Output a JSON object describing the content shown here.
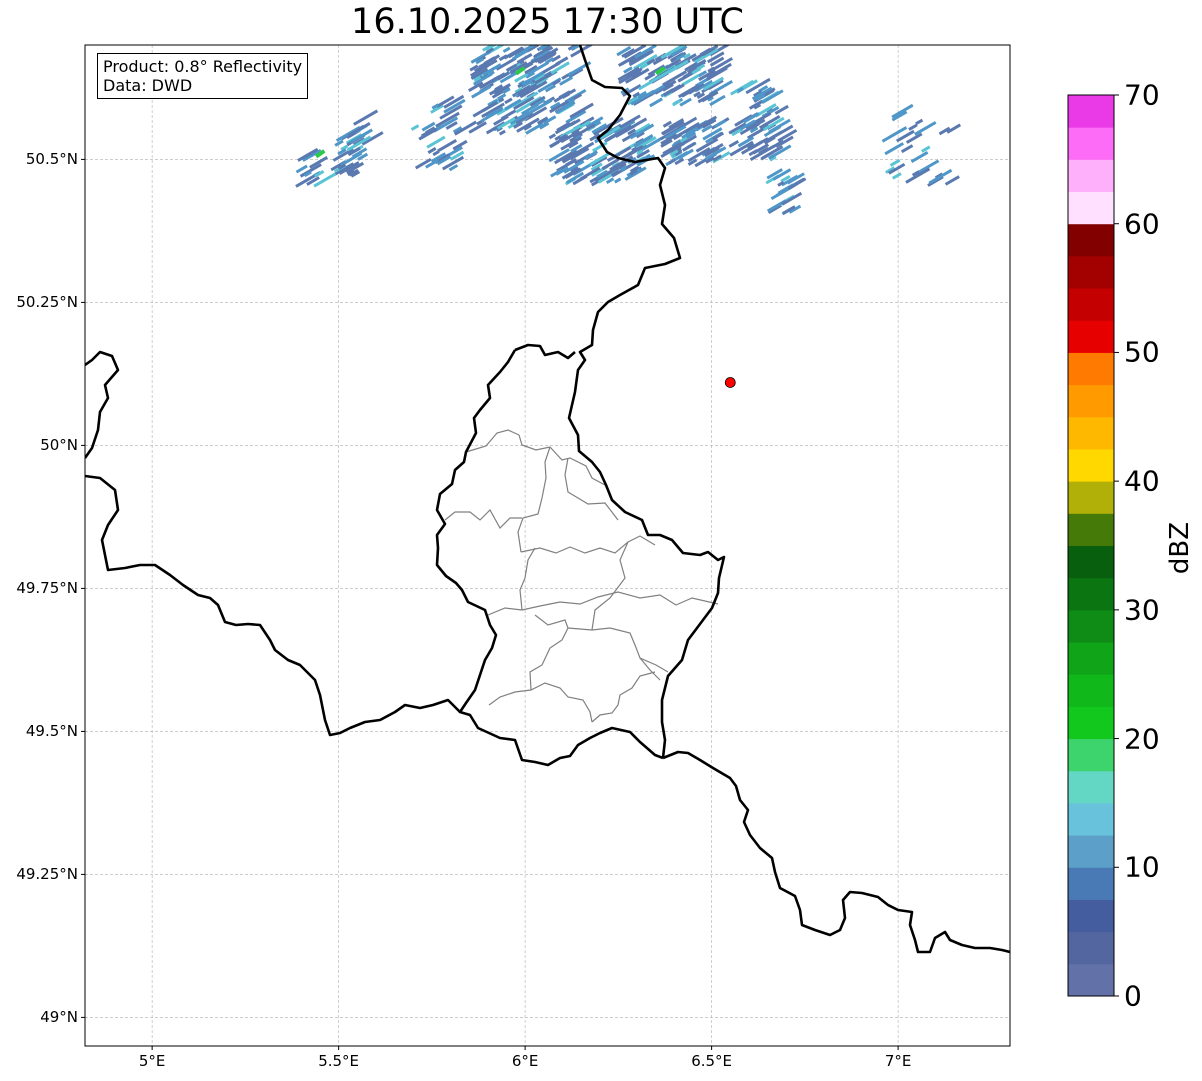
{
  "title": "16.10.2025 17:30 UTC",
  "infobox": {
    "product": "Product: 0.8° Reflectivity",
    "source": "Data: DWD"
  },
  "axes": {
    "lon_ticks": [
      "5°E",
      "5.5°E",
      "6°E",
      "6.5°E",
      "7°E"
    ],
    "lat_ticks": [
      "50.5°N",
      "50.25°N",
      "50°N",
      "49.75°N",
      "49.5°N",
      "49.25°N",
      "49°N"
    ],
    "lon_range": [
      4.82,
      7.3
    ],
    "lat_range": [
      48.95,
      50.7
    ],
    "grid": true
  },
  "colorbar": {
    "label": "dBZ",
    "ticks": [
      "70",
      "60",
      "50",
      "40",
      "30",
      "20",
      "10",
      "0"
    ],
    "range": [
      0,
      70
    ],
    "step": 2.5,
    "colors": [
      "#6272a8",
      "#5466a0",
      "#435d9e",
      "#4a7ab5",
      "#5c9fc8",
      "#68c2dc",
      "#63d6c4",
      "#3ed46d",
      "#13c81d",
      "#10b81a",
      "#10a418",
      "#0e8c16",
      "#0b7512",
      "#085f0d",
      "#457a08",
      "#b0b008",
      "#ffd800",
      "#ffb800",
      "#ff9a00",
      "#ff7a00",
      "#e60000",
      "#c40000",
      "#a30000",
      "#820000",
      "#ffe0fe",
      "#ffb0fb",
      "#fd6cf6",
      "#ea3ae8"
    ]
  },
  "marker": {
    "lon": 6.55,
    "lat": 50.11,
    "color": "#ff0000"
  },
  "echo_colors": {
    "weak": "#5a79b0",
    "medium": "#4f97c8",
    "strong": "#5bc4d4",
    "green": "#2cc84a"
  }
}
